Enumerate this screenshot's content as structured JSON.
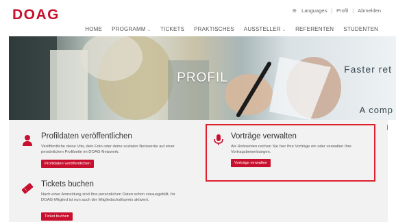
{
  "logo": "DOAG",
  "topbar": {
    "languages": "Languages",
    "profil": "Profil",
    "separator": "|",
    "abmelden": "Abmelden"
  },
  "nav": {
    "home": "HOME",
    "programm": "PROGRAMM",
    "tickets": "TICKETS",
    "praktisches": "PRAKTISCHES",
    "aussteller": "AUSSTELLER",
    "referenten": "REFERENTEN",
    "studenten": "STUDENTEN",
    "caret": "⌄"
  },
  "hero": {
    "title": "PROFIL",
    "bg_text_1": "Faster ret",
    "bg_text_2": "A comp"
  },
  "cards": {
    "profil": {
      "title": "Profildaten veröffentlichen",
      "desc": "Veröffentliche deine Vita, dein Foto oder deine sozialen Netzwerke auf einer persönlichen Profilseite im DOAG-Netzwerk.",
      "button": "Profildaten veröffentlichen",
      "icon": "person-icon"
    },
    "vortraege": {
      "title": "Vorträge verwalten",
      "desc": "Als Referenten reichen Sie hier Ihre Vorträge ein oder verwalten Ihre Vortragsbewerbungen.",
      "button": "Vorträge verwalten",
      "icon": "microphone-icon"
    },
    "tickets": {
      "title": "Tickets buchen",
      "desc": "Nach einer Anmeldung sind Ihre persönlichen Daten schon vorausgefüllt, für DOAG-Mitglied ist nun auch der Mitgliedschaftspreis aktiviert.",
      "button": "Ticket buchen",
      "icon": "ticket-icon"
    }
  },
  "colors": {
    "brand_red": "#c8102e",
    "highlight_red": "#e01e2e"
  }
}
